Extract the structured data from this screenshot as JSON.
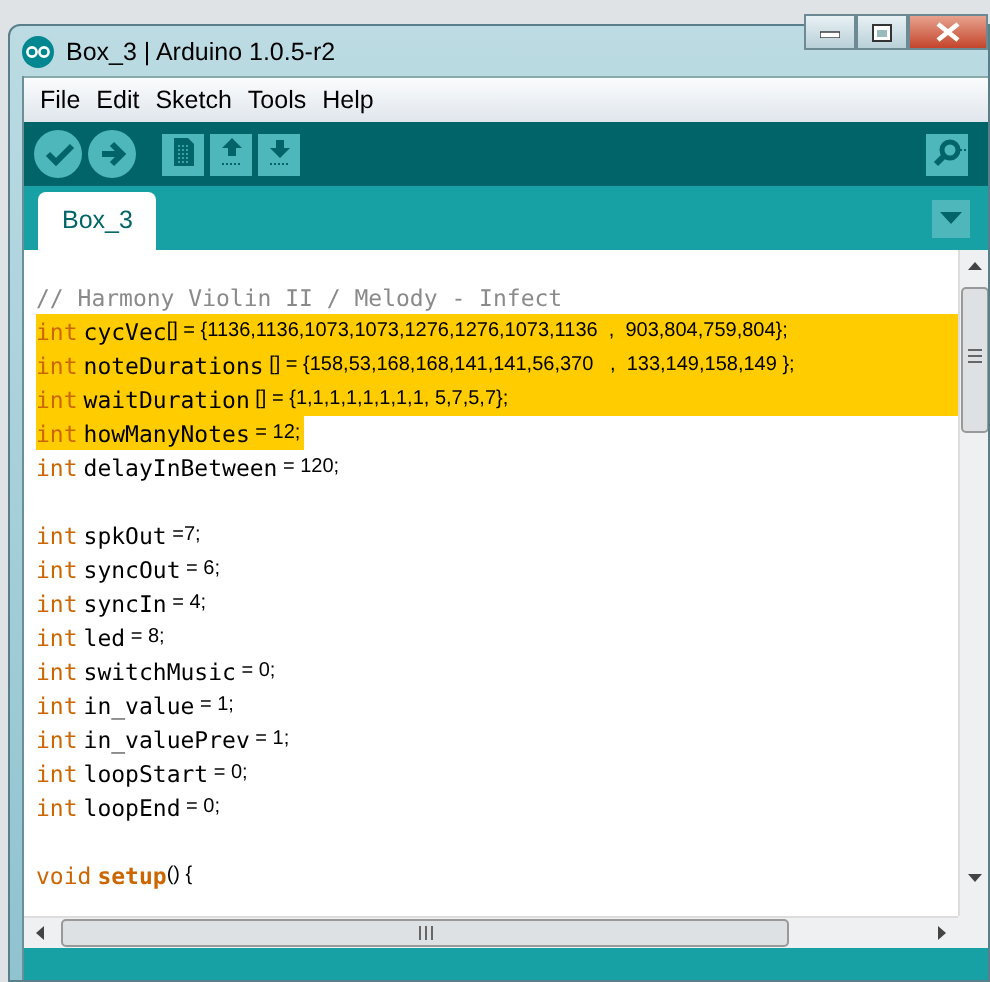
{
  "window": {
    "title": "Box_3 | Arduino 1.0.5-r2"
  },
  "menu": [
    "File",
    "Edit",
    "Sketch",
    "Tools",
    "Help"
  ],
  "toolbar": [
    {
      "kind": "verify"
    },
    {
      "kind": "upload"
    },
    {
      "kind": "new"
    },
    {
      "kind": "open"
    },
    {
      "kind": "save"
    },
    {
      "kind": "serial"
    }
  ],
  "tabs": [
    {
      "label": "Box_3",
      "selected": true
    }
  ],
  "code_lines": [
    {
      "highlighted": false,
      "tokens": [
        {
          "kind": "comment",
          "text": "// Harmony Violin II / Melody - Infect"
        }
      ]
    },
    {
      "highlighted": true,
      "tokens": [
        {
          "kind": "keyword",
          "text": "int"
        },
        {
          "kind": "name",
          "text": "cycVec"
        },
        {
          "kind": "plain",
          "text": "[] = {1136,1136,1073,1073,1276,1276,1073,1136  ,  903,804,759,804};"
        }
      ]
    },
    {
      "highlighted": true,
      "tokens": [
        {
          "kind": "keyword",
          "text": "int"
        },
        {
          "kind": "name",
          "text": "noteDurations"
        },
        {
          "kind": "plain",
          "text": " [] = {158,53,168,168,141,141,56,370   ,  133,149,158,149 };"
        }
      ]
    },
    {
      "highlighted": true,
      "tokens": [
        {
          "kind": "keyword",
          "text": "int"
        },
        {
          "kind": "name",
          "text": "waitDuration"
        },
        {
          "kind": "plain",
          "text": " [] = {1,1,1,1,1,1,1,1, 5,7,5,7};"
        }
      ]
    },
    {
      "highlighted": true,
      "tokens": [
        {
          "kind": "keyword",
          "text": "int"
        },
        {
          "kind": "name",
          "text": "howManyNotes"
        },
        {
          "kind": "plain",
          "text": " = 12;"
        }
      ]
    },
    {
      "highlighted": false,
      "tokens": [
        {
          "kind": "keyword",
          "text": "int"
        },
        {
          "kind": "name",
          "text": "delayInBetween"
        },
        {
          "kind": "plain",
          "text": " = 120;"
        }
      ]
    },
    {
      "highlighted": false
    },
    {
      "highlighted": false,
      "tokens": [
        {
          "kind": "keyword",
          "text": "int"
        },
        {
          "kind": "name",
          "text": "spkOut"
        },
        {
          "kind": "plain",
          "text": " =7;"
        }
      ]
    },
    {
      "highlighted": false,
      "tokens": [
        {
          "kind": "keyword",
          "text": "int"
        },
        {
          "kind": "name",
          "text": "syncOut"
        },
        {
          "kind": "plain",
          "text": " = 6;"
        }
      ]
    },
    {
      "highlighted": false,
      "tokens": [
        {
          "kind": "keyword",
          "text": "int"
        },
        {
          "kind": "name",
          "text": "syncIn"
        },
        {
          "kind": "plain",
          "text": " = 4;"
        }
      ]
    },
    {
      "highlighted": false,
      "tokens": [
        {
          "kind": "keyword",
          "text": "int"
        },
        {
          "kind": "name",
          "text": "led"
        },
        {
          "kind": "plain",
          "text": " = 8;"
        }
      ]
    },
    {
      "highlighted": false,
      "tokens": [
        {
          "kind": "keyword",
          "text": "int"
        },
        {
          "kind": "name",
          "text": "switchMusic"
        },
        {
          "kind": "plain",
          "text": " = 0;"
        }
      ]
    },
    {
      "highlighted": false,
      "tokens": [
        {
          "kind": "keyword",
          "text": "int"
        },
        {
          "kind": "name",
          "text": "in_value"
        },
        {
          "kind": "plain",
          "text": " = 1;"
        }
      ]
    },
    {
      "highlighted": false,
      "tokens": [
        {
          "kind": "keyword",
          "text": "int"
        },
        {
          "kind": "name",
          "text": "in_valuePrev"
        },
        {
          "kind": "plain",
          "text": " = 1;"
        }
      ]
    },
    {
      "highlighted": false,
      "tokens": [
        {
          "kind": "keyword",
          "text": "int"
        },
        {
          "kind": "name",
          "text": "loopStart"
        },
        {
          "kind": "plain",
          "text": " = 0;"
        }
      ]
    },
    {
      "highlighted": false,
      "tokens": [
        {
          "kind": "keyword",
          "text": "int"
        },
        {
          "kind": "name",
          "text": "loopEnd"
        },
        {
          "kind": "plain",
          "text": " = 0;"
        }
      ]
    },
    {
      "highlighted": false
    },
    {
      "highlighted": false,
      "tokens": [
        {
          "kind": "keyword",
          "text": "void"
        },
        {
          "kind": "function",
          "text": "setup"
        },
        {
          "kind": "plain",
          "text": "() {"
        }
      ]
    }
  ]
}
